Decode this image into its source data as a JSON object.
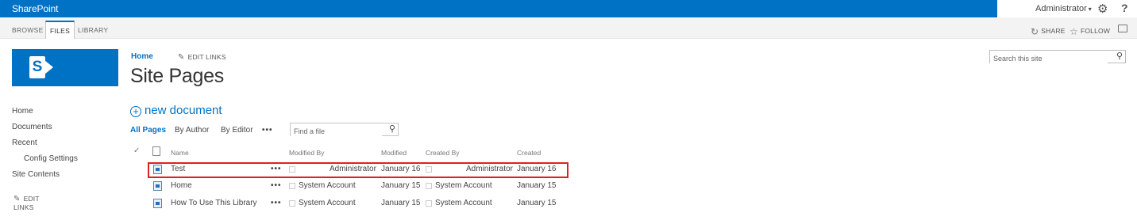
{
  "suitebar": {
    "brand": "SharePoint",
    "user": "Administrator",
    "help": "?"
  },
  "ribbon": {
    "tabs": [
      "BROWSE",
      "FILES",
      "LIBRARY"
    ],
    "actions": {
      "share": "SHARE",
      "follow": "FOLLOW"
    }
  },
  "breadcrumb": {
    "home": "Home",
    "edit_links": "EDIT LINKS"
  },
  "page_title": "Site Pages",
  "site_search": {
    "placeholder": "Search this site"
  },
  "nav": {
    "items": [
      "Home",
      "Documents",
      "Recent",
      "Config Settings",
      "Site Contents"
    ],
    "edit_links": "EDIT LINKS"
  },
  "main": {
    "new_document": "new document",
    "views": [
      "All Pages",
      "By Author",
      "By Editor",
      "•••"
    ],
    "file_search_placeholder": "Find a file",
    "columns": [
      "Name",
      "Modified By",
      "Modified",
      "Created By",
      "Created"
    ],
    "rows": [
      {
        "name": "Test",
        "modified_by": "Administrator",
        "modified": "January 16",
        "created_by": "Administrator",
        "created": "January 16"
      },
      {
        "name": "Home",
        "modified_by": "System Account",
        "modified": "January 15",
        "created_by": "System Account",
        "created": "January 15"
      },
      {
        "name": "How To Use This Library",
        "modified_by": "System Account",
        "modified": "January 15",
        "created_by": "System Account",
        "created": "January 15"
      }
    ],
    "row_menu": "•••"
  },
  "colors": {
    "brand_blue": "#0072c6",
    "highlight_red": "#e02020"
  }
}
